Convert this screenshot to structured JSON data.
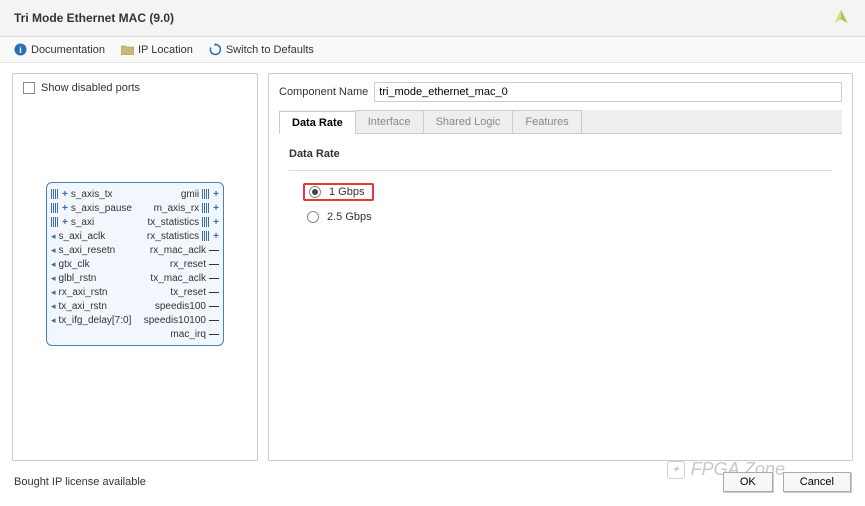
{
  "header": {
    "title": "Tri Mode Ethernet MAC (9.0)"
  },
  "toolbar": {
    "doc_label": "Documentation",
    "iploc_label": "IP Location",
    "switch_label": "Switch to Defaults"
  },
  "left": {
    "show_disabled_label": "Show disabled ports",
    "ports_left": [
      {
        "name": "s_axis_tx",
        "pin": "bus+"
      },
      {
        "name": "s_axis_pause",
        "pin": "bus+"
      },
      {
        "name": "s_axi",
        "pin": "bus+"
      },
      {
        "name": "s_axi_aclk",
        "pin": "arrow"
      },
      {
        "name": "s_axi_resetn",
        "pin": "arrow"
      },
      {
        "name": "gtx_clk",
        "pin": "arrow"
      },
      {
        "name": "glbl_rstn",
        "pin": "arrow"
      },
      {
        "name": "rx_axi_rstn",
        "pin": "arrow"
      },
      {
        "name": "tx_axi_rstn",
        "pin": "arrow"
      },
      {
        "name": "tx_ifg_delay[7:0]",
        "pin": "arrow"
      }
    ],
    "ports_right": [
      {
        "name": "gmii",
        "pin": "+bus"
      },
      {
        "name": "m_axis_rx",
        "pin": "+bus"
      },
      {
        "name": "tx_statistics",
        "pin": "+bus"
      },
      {
        "name": "rx_statistics",
        "pin": "+bus"
      },
      {
        "name": "rx_mac_aclk",
        "pin": "dash"
      },
      {
        "name": "rx_reset",
        "pin": "dash"
      },
      {
        "name": "tx_mac_aclk",
        "pin": "dash"
      },
      {
        "name": "tx_reset",
        "pin": "dash"
      },
      {
        "name": "speedis100",
        "pin": "dash"
      },
      {
        "name": "speedis10100",
        "pin": "dash"
      },
      {
        "name": "mac_irq",
        "pin": "dash"
      }
    ]
  },
  "right": {
    "component_label": "Component Name",
    "component_value": "tri_mode_ethernet_mac_0",
    "tabs": [
      "Data Rate",
      "Interface",
      "Shared Logic",
      "Features"
    ],
    "active_tab": 0,
    "section_title": "Data Rate",
    "options": [
      {
        "label": "1 Gbps",
        "checked": true,
        "highlight": true
      },
      {
        "label": "2.5 Gbps",
        "checked": false,
        "highlight": false
      }
    ]
  },
  "footer": {
    "license_text": "Bought IP license available",
    "ok_label": "OK",
    "cancel_label": "Cancel"
  },
  "watermark": {
    "text": "FPGA Zone"
  }
}
